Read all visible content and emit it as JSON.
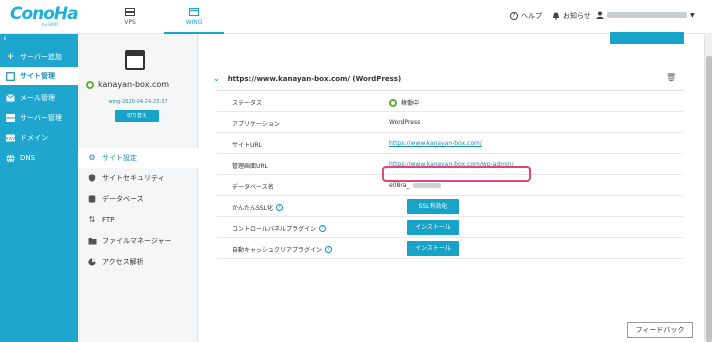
{
  "header": {
    "logo": "ConoHa",
    "logo_sub": "by GMO",
    "tabs": [
      {
        "label": "VPS",
        "icon": "server-icon"
      },
      {
        "label": "WING",
        "icon": "wing-icon"
      }
    ],
    "help": "ヘルプ",
    "notice": "お知らせ"
  },
  "sidebar": {
    "items": [
      {
        "label": "サーバー追加",
        "icon": "plus-icon"
      },
      {
        "label": "サイト管理",
        "icon": "site-icon"
      },
      {
        "label": "メール管理",
        "icon": "mail-icon"
      },
      {
        "label": "サーバー管理",
        "icon": "server-icon"
      },
      {
        "label": "ドメイン",
        "icon": "domain-icon"
      },
      {
        "label": "DNS",
        "icon": "globe-icon"
      }
    ]
  },
  "site": {
    "domain": "kanayan-box.com",
    "sub": "wing-2020-04-24-23-37",
    "switch_label": "切り替え",
    "menu": [
      {
        "label": "サイト設定",
        "icon": "settings-icon"
      },
      {
        "label": "サイトセキュリティ",
        "icon": "shield-icon"
      },
      {
        "label": "データベース",
        "icon": "database-icon"
      },
      {
        "label": "FTP",
        "icon": "transfer-icon"
      },
      {
        "label": "ファイルマネージャー",
        "icon": "folder-icon"
      },
      {
        "label": "アクセス解析",
        "icon": "chart-icon"
      }
    ]
  },
  "main": {
    "section_title": "https://www.kanayan-box.com/ (WordPress)",
    "rows": [
      {
        "label": "ステータス",
        "value": "稼働中"
      },
      {
        "label": "アプリケーション",
        "value": "WordPress"
      },
      {
        "label": "サイトURL",
        "value": "https://www.kanayan-box.com/"
      },
      {
        "label": "管理画面URL",
        "value": "https://www.kanayan-box.com/wp-admin/"
      },
      {
        "label": "データベース名",
        "value": "e08ra_"
      },
      {
        "label": "かんたんSSL化",
        "button": "SSL有効化"
      },
      {
        "label": "コントロールパネルプラグイン",
        "button": "インストール"
      },
      {
        "label": "自動キャッシュクリアプラグイン",
        "button": "インストール"
      }
    ]
  },
  "feedback": "フィードバック",
  "colors": {
    "accent": "#1ea6cf",
    "running": "#5bb12f",
    "highlight": "#e0457b"
  }
}
